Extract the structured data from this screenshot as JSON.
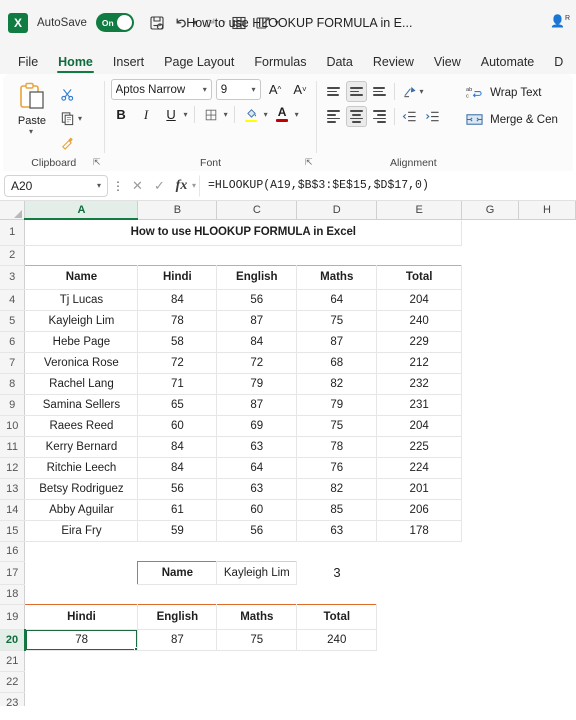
{
  "titlebar": {
    "app_logo": "excel-logo",
    "autosave_label": "AutoSave",
    "autosave_state": "On",
    "document_title": "How to use HLOOKUP FORMULA in E...",
    "qat": [
      {
        "name": "save-icon",
        "enabled": true
      },
      {
        "name": "undo-icon",
        "enabled": true
      },
      {
        "name": "redo-icon",
        "enabled": false
      },
      {
        "name": "table-icon",
        "enabled": true
      },
      {
        "name": "touch-mode-icon",
        "enabled": true
      },
      {
        "name": "customize-qat-icon",
        "enabled": true
      }
    ],
    "account_icon": "person-icon"
  },
  "ribbon": {
    "tabs": [
      {
        "label": "File",
        "active": false
      },
      {
        "label": "Home",
        "active": true
      },
      {
        "label": "Insert",
        "active": false
      },
      {
        "label": "Page Layout",
        "active": false
      },
      {
        "label": "Formulas",
        "active": false
      },
      {
        "label": "Data",
        "active": false
      },
      {
        "label": "Review",
        "active": false
      },
      {
        "label": "View",
        "active": false
      },
      {
        "label": "Automate",
        "active": false
      },
      {
        "label": "D",
        "active": false
      }
    ],
    "clipboard": {
      "group_label": "Clipboard",
      "paste_label": "Paste",
      "cut_icon": "scissors-icon",
      "copy_icon": "copy-icon",
      "format_painter_icon": "paintbrush-icon",
      "dialog_launcher": "dialog-launcher-icon"
    },
    "font": {
      "group_label": "Font",
      "font_name": "Aptos Narrow",
      "font_size": "9",
      "grow_font": "A",
      "shrink_font": "A",
      "bold": "B",
      "italic": "I",
      "underline": "U",
      "borders_icon": "borders-icon",
      "fill_color_icon": "fill-color-icon",
      "fill_color": "#FFFF00",
      "font_color_icon": "font-color-icon",
      "font_color": "#C00000",
      "dialog_launcher": "dialog-launcher-icon"
    },
    "alignment": {
      "group_label": "Alignment",
      "align_top": "align-top-icon",
      "align_middle": "align-middle-icon",
      "align_bottom": "align-bottom-icon",
      "orientation": "orientation-icon",
      "align_left": "align-left-icon",
      "align_center": "align-center-icon",
      "align_right": "align-right-icon",
      "decrease_indent": "decrease-indent-icon",
      "increase_indent": "increase-indent-icon",
      "wrap_text": "Wrap Text",
      "merge_center": "Merge & Cen"
    }
  },
  "formula_bar": {
    "name_box": "A20",
    "cancel_icon": "cancel-icon",
    "enter_icon": "enter-icon",
    "function_icon": "fx-icon",
    "formula": "=HLOOKUP(A19,$B$3:$E$15,$D$17,0)"
  },
  "sheet": {
    "columns": [
      "A",
      "B",
      "C",
      "D",
      "E",
      "G",
      "H"
    ],
    "selected_column": "A",
    "selected_row": "20",
    "selected_cell": "A20",
    "rows": [
      "1",
      "2",
      "3",
      "4",
      "5",
      "6",
      "7",
      "8",
      "9",
      "10",
      "11",
      "12",
      "13",
      "14",
      "15",
      "16",
      "17",
      "18",
      "19",
      "20",
      "21",
      "22",
      "23"
    ],
    "title_banner": "How to use HLOOKUP FORMULA in Excel",
    "main_table": {
      "headers": [
        "Name",
        "Hindi",
        "English",
        "Maths",
        "Total"
      ],
      "rows": [
        [
          "Tj Lucas",
          "84",
          "56",
          "64",
          "204"
        ],
        [
          "Kayleigh Lim",
          "78",
          "87",
          "75",
          "240"
        ],
        [
          "Hebe Page",
          "58",
          "84",
          "87",
          "229"
        ],
        [
          "Veronica Rose",
          "72",
          "72",
          "68",
          "212"
        ],
        [
          "Rachel Lang",
          "71",
          "79",
          "82",
          "232"
        ],
        [
          "Samina Sellers",
          "65",
          "87",
          "79",
          "231"
        ],
        [
          "Raees Reed",
          "60",
          "69",
          "75",
          "204"
        ],
        [
          "Kerry Bernard",
          "84",
          "63",
          "78",
          "225"
        ],
        [
          "Ritchie Leech",
          "84",
          "64",
          "76",
          "224"
        ],
        [
          "Betsy Rodriguez",
          "56",
          "63",
          "82",
          "201"
        ],
        [
          "Abby Aguilar",
          "61",
          "60",
          "85",
          "206"
        ],
        [
          "Eira Fry",
          "59",
          "56",
          "63",
          "178"
        ]
      ]
    },
    "lookup_row": {
      "label": "Name",
      "value": "Kayleigh Lim",
      "row_index": "3"
    },
    "result_table": {
      "headers": [
        "Hindi",
        "English",
        "Maths",
        "Total"
      ],
      "values": [
        "78",
        "87",
        "75",
        "240"
      ]
    }
  },
  "colors": {
    "title_banner_bg": "#1B9DD9",
    "green_header_bg": "#92D050",
    "orange_header_bg": "#E97132",
    "excel_green": "#107C41",
    "selection_border": "#1B6B3F"
  }
}
